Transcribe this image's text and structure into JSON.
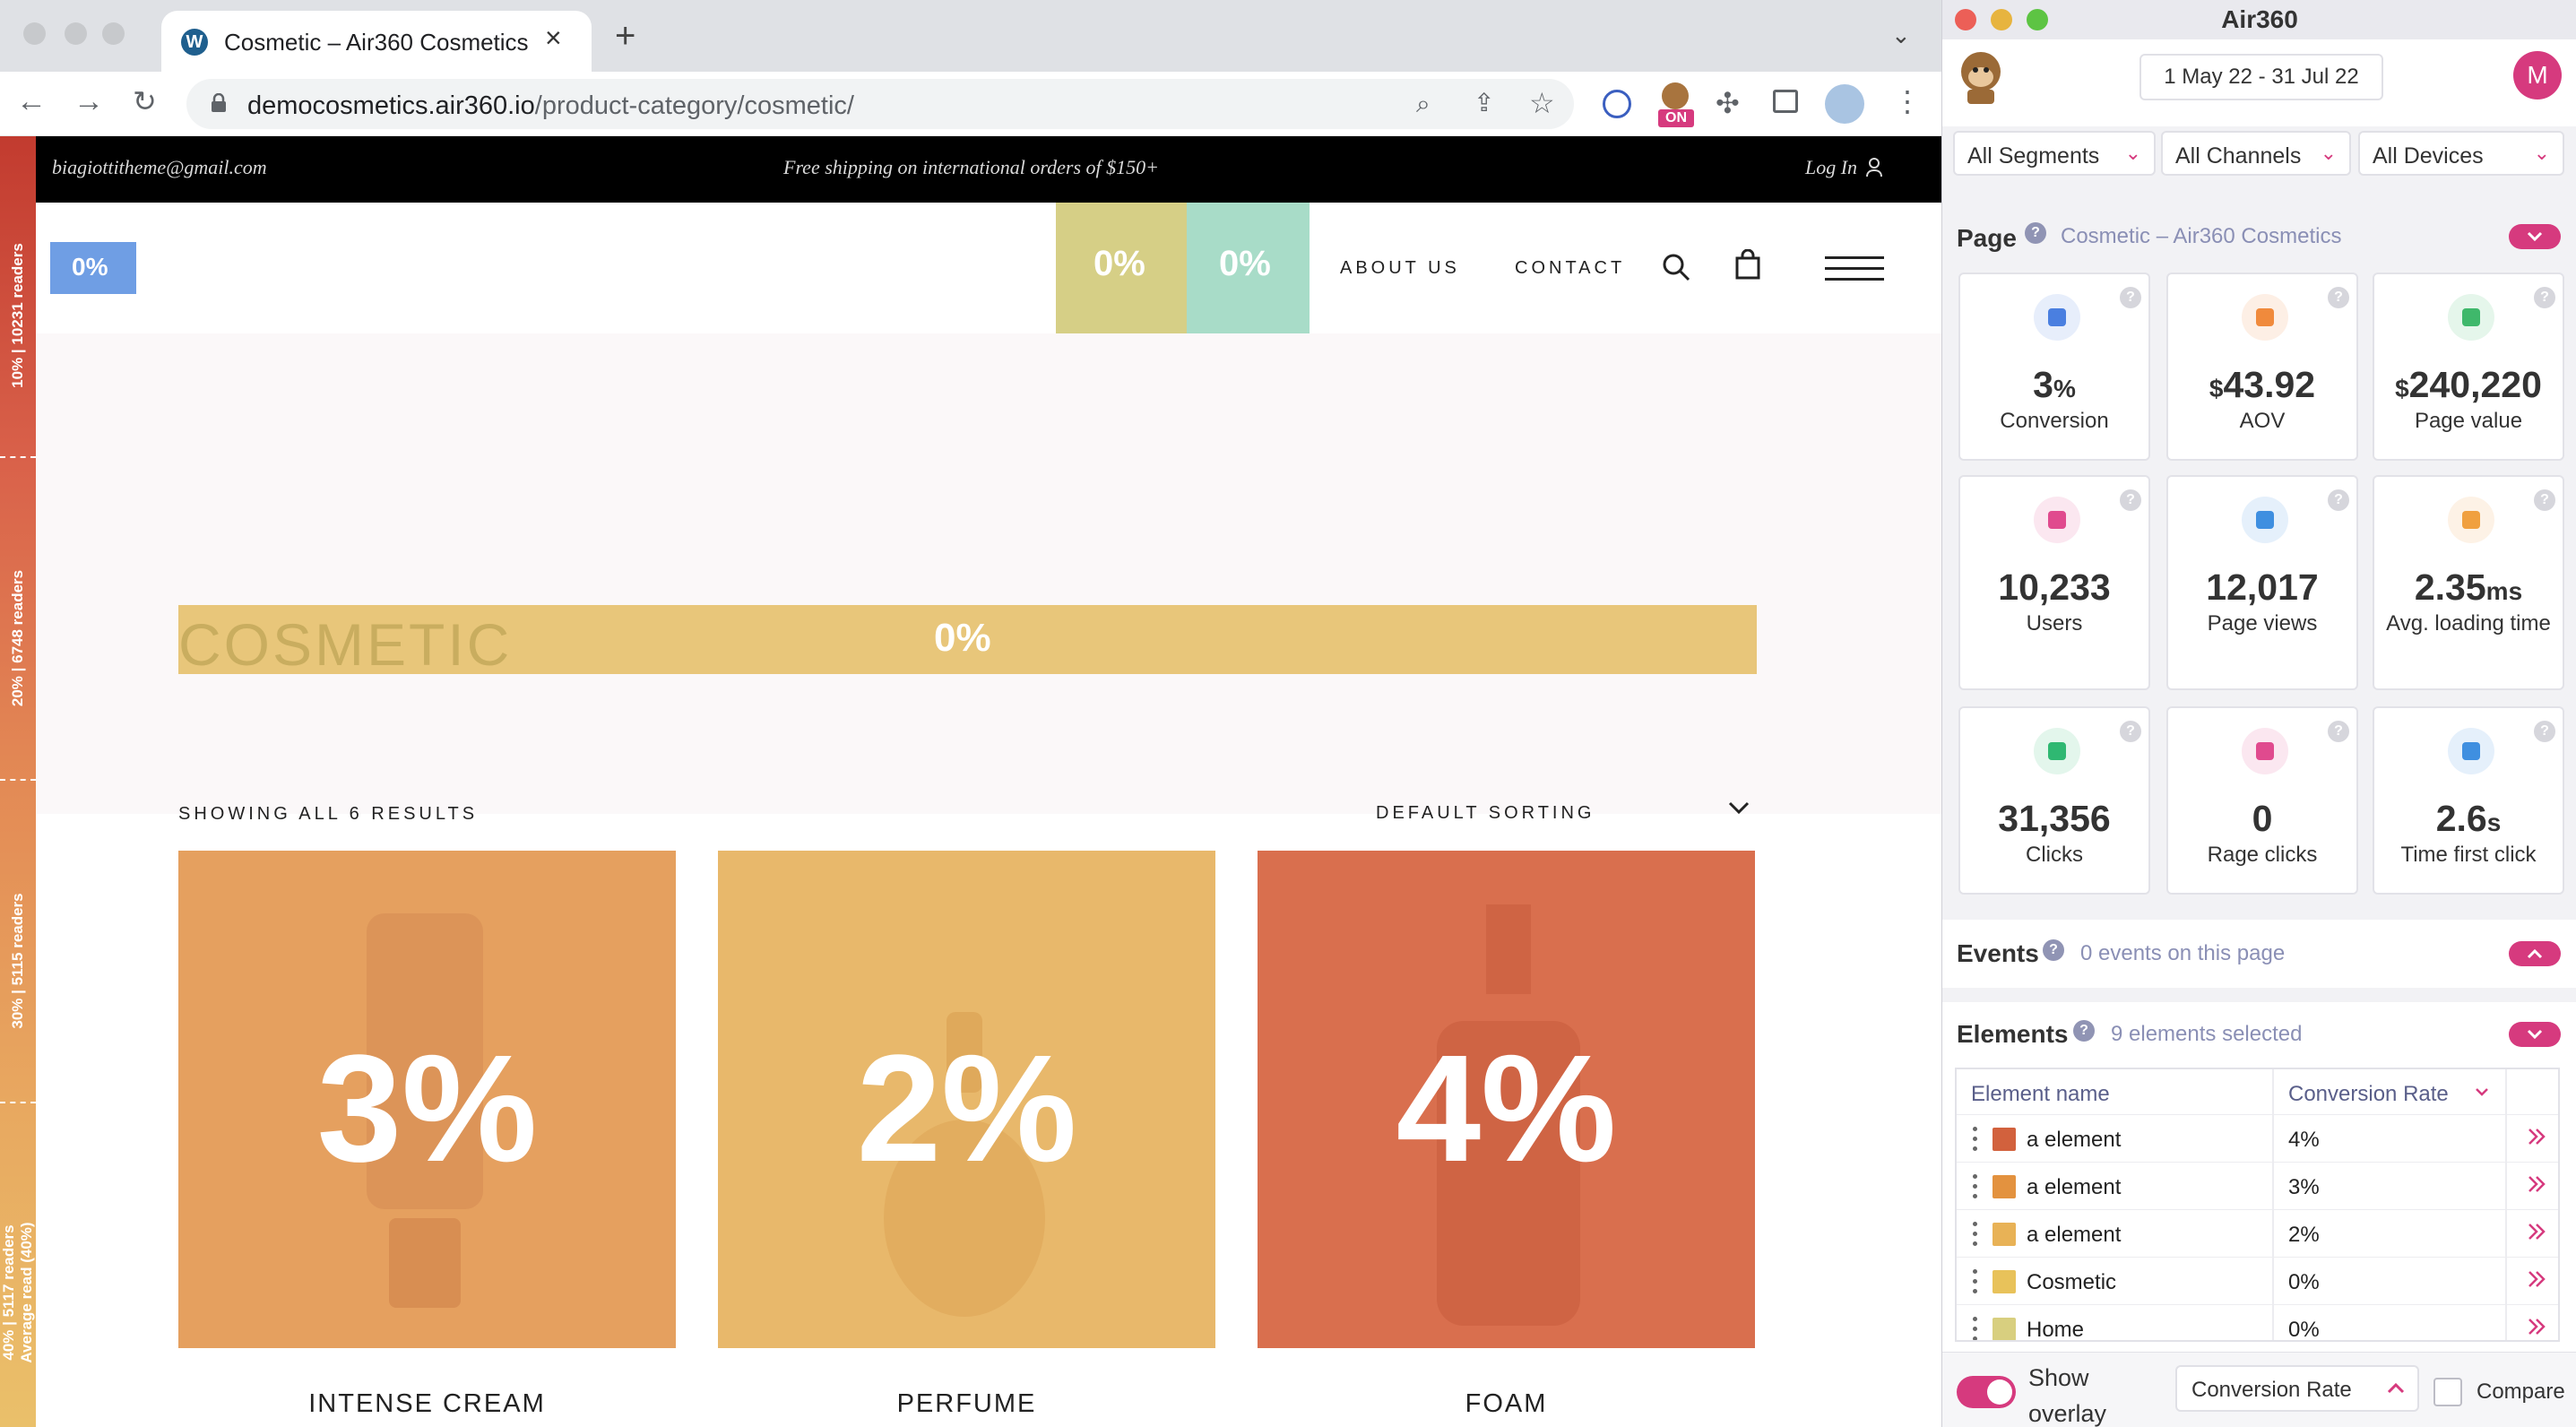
{
  "browser": {
    "tab_title": "Cosmetic – Air360 Cosmetics",
    "url_host": "democosmetics.air360.io",
    "url_path": "/product-category/cosmetic/",
    "extension_badge": "ON"
  },
  "site": {
    "topbar": {
      "email": "biagiottitheme@gmail.com",
      "shipping": "Free shipping on international orders of $150+",
      "login": "Log In"
    },
    "logo_overlay_pct": "0%",
    "nav": {
      "about": "ABOUT US",
      "contact": "CONTACT",
      "overlay_pct_1": "0%",
      "overlay_pct_2": "0%"
    },
    "hero": {
      "title": "COSMETIC",
      "overlay_pct": "0%"
    },
    "results_label": "SHOWING ALL 6 RESULTS",
    "sorting_label": "DEFAULT SORTING",
    "products": [
      {
        "name": "INTENSE CREAM",
        "overlay_pct": "3%",
        "color": "#e5a05f"
      },
      {
        "name": "PERFUME",
        "overlay_pct": "2%",
        "color": "#e8b86b"
      },
      {
        "name": "FOAM",
        "overlay_pct": "4%",
        "color": "#d96f4e"
      }
    ],
    "scroll_map": [
      {
        "pct": "10%",
        "readers": "10231 readers"
      },
      {
        "pct": "20%",
        "readers": "6748 readers"
      },
      {
        "pct": "30%",
        "readers": "5115 readers"
      },
      {
        "pct": "40%",
        "readers": "5117 readers",
        "note": "Average read (40%)"
      }
    ]
  },
  "panel": {
    "app_title": "Air360",
    "date_range": "1 May 22 - 31 Jul 22",
    "avatar_initial": "M",
    "filters": {
      "segments": "All Segments",
      "channels": "All Channels",
      "devices": "All Devices"
    },
    "page_section": {
      "label": "Page",
      "page_name": "Cosmetic – Air360 Cosmetics"
    },
    "metrics": [
      {
        "value": "3",
        "unit": "%",
        "prefix": "",
        "label": "Conversion",
        "icon": "trend-up-icon",
        "color": "#4a7fe0"
      },
      {
        "value": "43.92",
        "unit": "",
        "prefix": "$",
        "label": "AOV",
        "icon": "cart-icon",
        "color": "#f08a3c"
      },
      {
        "value": "240,220",
        "unit": "",
        "prefix": "$",
        "label": "Page value",
        "icon": "dollar-icon",
        "color": "#3fb86b"
      },
      {
        "value": "10,233",
        "unit": "",
        "prefix": "",
        "label": "Users",
        "icon": "users-icon",
        "color": "#e04a8e"
      },
      {
        "value": "12,017",
        "unit": "",
        "prefix": "",
        "label": "Page views",
        "icon": "eye-icon",
        "color": "#3f8fe0"
      },
      {
        "value": "2.35",
        "unit": "ms",
        "prefix": "",
        "label": "Avg. loading time",
        "icon": "loading-icon",
        "color": "#f0a040"
      },
      {
        "value": "31,356",
        "unit": "",
        "prefix": "",
        "label": "Clicks",
        "icon": "pointer-icon",
        "color": "#2fb872"
      },
      {
        "value": "0",
        "unit": "",
        "prefix": "",
        "label": "Rage clicks",
        "icon": "rage-pointer-icon",
        "color": "#e04a8e"
      },
      {
        "value": "2.6",
        "unit": "s",
        "prefix": "",
        "label": "Time first click",
        "icon": "clock-icon",
        "color": "#3f8fe0"
      }
    ],
    "events": {
      "label": "Events",
      "summary": "0 events on this page"
    },
    "elements": {
      "label": "Elements",
      "summary": "9 elements selected",
      "col_name": "Element name",
      "col_metric": "Conversion Rate",
      "rows": [
        {
          "name": "a element",
          "value": "4%",
          "color": "#d2613d"
        },
        {
          "name": "a element",
          "value": "3%",
          "color": "#e3923f"
        },
        {
          "name": "a element",
          "value": "2%",
          "color": "#e8b256"
        },
        {
          "name": "Cosmetic",
          "value": "0%",
          "color": "#e8c25a"
        },
        {
          "name": "Home",
          "value": "0%",
          "color": "#d8cf7f"
        }
      ]
    },
    "footer": {
      "show_overlay": "Show overlay",
      "metric_select": "Conversion Rate",
      "compare": "Compare"
    }
  }
}
